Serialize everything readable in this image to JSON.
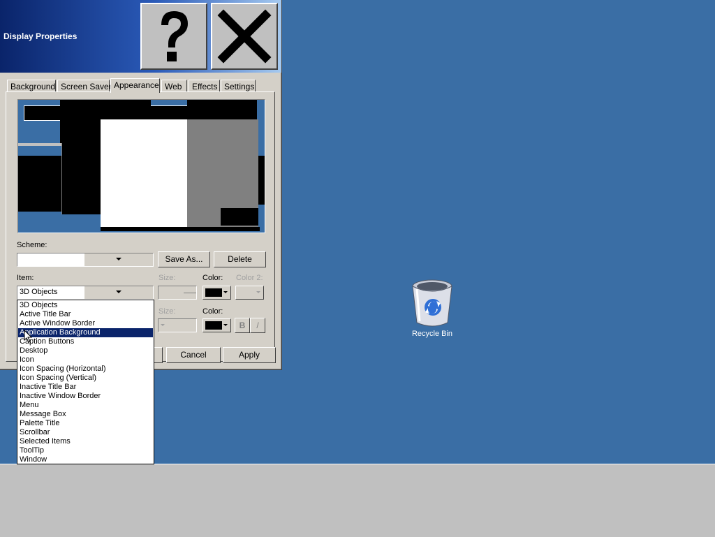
{
  "dialog": {
    "title": "Display Properties",
    "help_icon": "question-mark-icon",
    "close_icon": "close-x-icon"
  },
  "tabs": [
    {
      "label": "Background"
    },
    {
      "label": "Screen Saver"
    },
    {
      "label": "Appearance"
    },
    {
      "label": "Web"
    },
    {
      "label": "Effects"
    },
    {
      "label": "Settings"
    }
  ],
  "active_tab": "Appearance",
  "appearance": {
    "scheme_label": "Scheme:",
    "scheme_value": "",
    "save_as_label": "Save As...",
    "delete_label": "Delete",
    "item_label": "Item:",
    "item_value": "3D Objects",
    "size_label": "Size:",
    "color_label": "Color:",
    "color2_label": "Color 2:",
    "font_size_label": "Size:",
    "font_color_label": "Color:",
    "bold_label": "B",
    "italic_label": "/",
    "item_color": "#000000",
    "font_color": "#000000"
  },
  "item_list": {
    "items": [
      "3D Objects",
      "Active Title Bar",
      "Active Window Border",
      "Application Background",
      "Caption Buttons",
      "Desktop",
      "Icon",
      "Icon Spacing (Horizontal)",
      "Icon Spacing (Vertical)",
      "Inactive Title Bar",
      "Inactive Window Border",
      "Menu",
      "Message Box",
      "Palette Title",
      "Scrollbar",
      "Selected Items",
      "ToolTip",
      "Window"
    ],
    "selected": "Application Background"
  },
  "footer": {
    "cancel_label": "Cancel",
    "apply_label": "Apply"
  },
  "desktop": {
    "recycle_bin_label": "Recycle Bin",
    "background_color": "#3a6ea5"
  }
}
